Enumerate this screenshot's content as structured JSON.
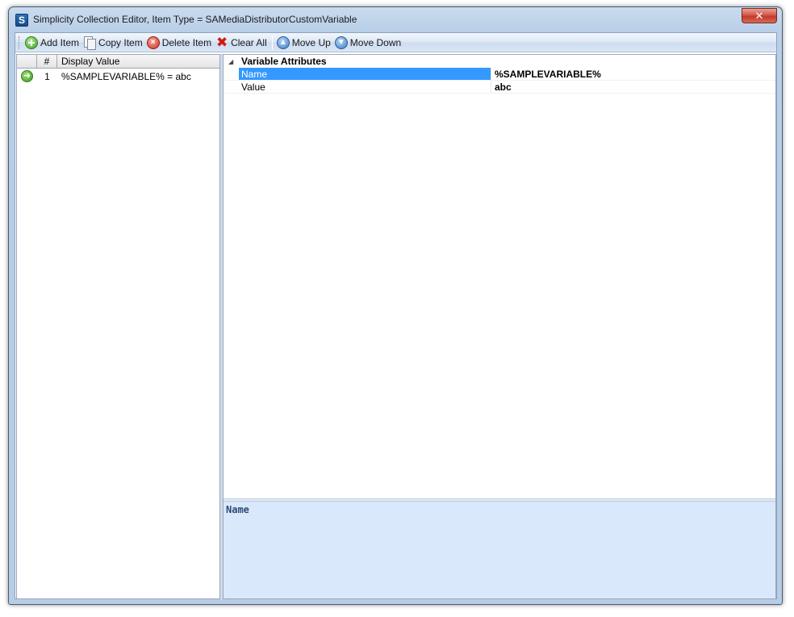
{
  "window": {
    "title": "Simplicity Collection Editor, Item Type = SAMediaDistributorCustomVariable",
    "icon_letter": "S",
    "close_glyph": "✕"
  },
  "toolbar": {
    "add_item": "Add Item",
    "copy_item": "Copy Item",
    "delete_item": "Delete Item",
    "clear_all": "Clear All",
    "move_up": "Move Up",
    "move_down": "Move Down"
  },
  "grid": {
    "headers": {
      "indicator": "",
      "number": "#",
      "display_value": "Display Value"
    },
    "rows": [
      {
        "number": "1",
        "display_value": "%SAMPLEVARIABLE% = abc",
        "current": true
      }
    ]
  },
  "property_grid": {
    "category": "Variable Attributes",
    "properties": [
      {
        "name": "Name",
        "value": "%SAMPLEVARIABLE%",
        "selected": true
      },
      {
        "name": "Value",
        "value": "abc",
        "selected": false
      }
    ],
    "help_title": "Name"
  },
  "colors": {
    "selection": "#3399ff",
    "help_background": "#dae8fb",
    "title_gradient_top": "#c9dbee"
  },
  "icons": {
    "add": "add-icon",
    "copy": "copy-icon",
    "delete": "delete-icon",
    "clear": "clear-icon",
    "move_up": "arrow-up-icon",
    "move_down": "arrow-down-icon",
    "current_row": "arrow-right-icon"
  }
}
